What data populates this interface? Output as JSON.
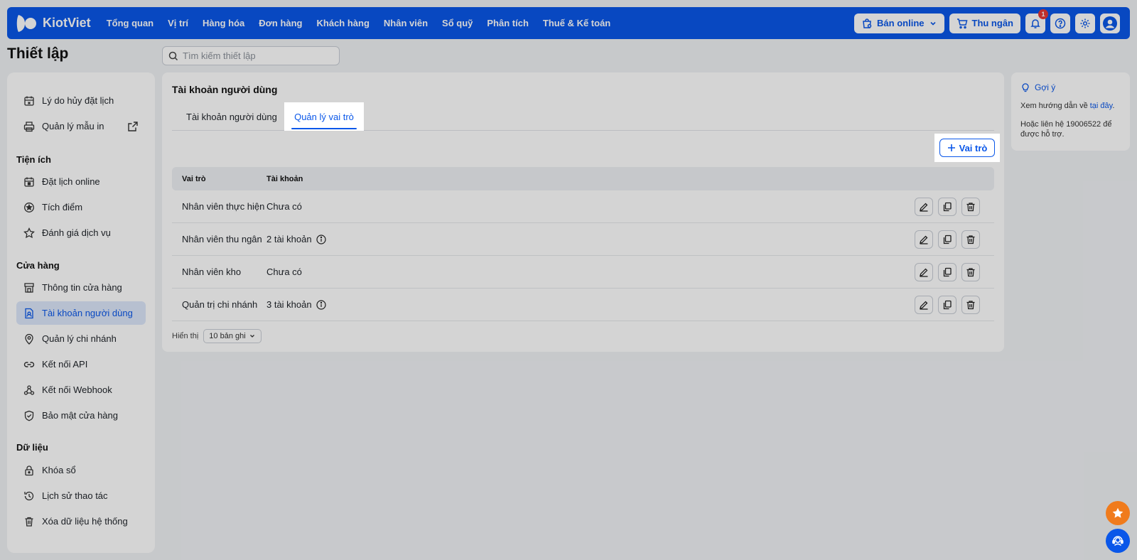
{
  "brand": {
    "name": "KiotViet"
  },
  "nav": {
    "items": [
      "Tổng quan",
      "Vị trí",
      "Hàng hóa",
      "Đơn hàng",
      "Khách hàng",
      "Nhân viên",
      "Sổ quỹ",
      "Phân tích",
      "Thuế & Kế toán"
    ]
  },
  "topbar": {
    "online_label": "Bán online",
    "cashier_label": "Thu ngân",
    "notification_count": "1"
  },
  "page": {
    "title": "Thiết lập",
    "search_placeholder": "Tìm kiếm thiết lập"
  },
  "sidebar": {
    "items_top": [
      {
        "label": "Lý do hủy đặt lịch",
        "icon": "calendar-cancel-icon"
      },
      {
        "label": "Quản lý mẫu in",
        "icon": "printer-icon"
      }
    ],
    "sections": [
      {
        "title": "Tiện ích",
        "items": [
          {
            "label": "Đặt lịch online",
            "icon": "calendar-icon"
          },
          {
            "label": "Tích điểm",
            "icon": "points-icon"
          },
          {
            "label": "Đánh giá dịch vụ",
            "icon": "star-icon"
          }
        ]
      },
      {
        "title": "Cửa hàng",
        "items": [
          {
            "label": "Thông tin cửa hàng",
            "icon": "store-icon"
          },
          {
            "label": "Tài khoản người dùng",
            "icon": "user-file-icon",
            "active": true
          },
          {
            "label": "Quản lý chi nhánh",
            "icon": "location-icon"
          },
          {
            "label": "Kết nối API",
            "icon": "link-icon"
          },
          {
            "label": "Kết nối Webhook",
            "icon": "webhook-icon"
          },
          {
            "label": "Bảo mật cửa hàng",
            "icon": "shield-icon"
          }
        ]
      },
      {
        "title": "Dữ liệu",
        "items": [
          {
            "label": "Khóa sổ",
            "icon": "lock-icon"
          },
          {
            "label": "Lịch sử thao tác",
            "icon": "history-icon"
          },
          {
            "label": "Xóa dữ liệu hệ thống",
            "icon": "trash-icon"
          }
        ]
      }
    ]
  },
  "main": {
    "title": "Tài khoản người dùng",
    "tabs": [
      {
        "label": "Tài khoản người dùng",
        "active": false
      },
      {
        "label": "Quản lý vai trò",
        "active": true
      }
    ],
    "add_role_label": "Vai trò",
    "table": {
      "columns": [
        "Vai trò",
        "Tài khoản"
      ],
      "rows": [
        {
          "role": "Nhân viên thực hiện",
          "accounts": "Chưa có",
          "info": false
        },
        {
          "role": "Nhân viên thu ngân",
          "accounts": "2 tài khoản",
          "info": true
        },
        {
          "role": "Nhân viên kho",
          "accounts": "Chưa có",
          "info": false
        },
        {
          "role": "Quản trị chi nhánh",
          "accounts": "3 tài khoản",
          "info": true
        }
      ]
    },
    "footer": {
      "show_label": "Hiển thị",
      "page_size": "10 bản ghi"
    }
  },
  "hint": {
    "title": "Gợi ý",
    "line1_prefix": "Xem hướng dẫn về ",
    "line1_link": "tại đây",
    "line1_suffix": ".",
    "line2": "Hoặc liên hệ 19006522 để được hỗ trợ."
  },
  "colors": {
    "primary": "#0a57e9",
    "accent_orange": "#f07b1c",
    "badge_red": "#e53935"
  }
}
